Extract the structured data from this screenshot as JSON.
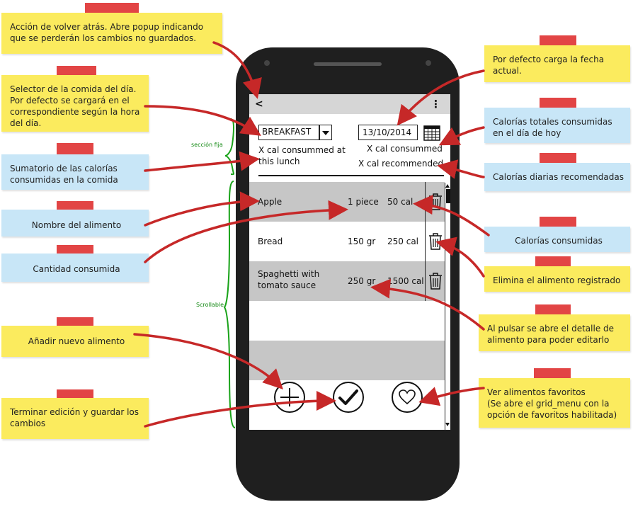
{
  "notes": {
    "back": "Acción de volver atrás. Abre popup indicando que se perderán los cambios no guardados.",
    "selector": "Selector de la comida del día. Por defecto se cargará en el correspondiente según la hora del día.",
    "sum_meal": "Sumatorio de las calorías consumidas en la comida",
    "food_name": "Nombre del alimento",
    "amount": "Cantidad consumida",
    "add_food": "Añadir nuevo alimento",
    "finish": "Terminar edición y guardar los cambios",
    "date": "Por defecto carga la fecha actual.",
    "total_day": "Calorías totales consumidas en el día de hoy",
    "daily_recommended": "Calorías diarias recomendadas",
    "calories": "Calorías consumidas",
    "delete": "Elimina el alimento registrado",
    "detail": "Al pulsar se abre el detalle de alimento para poder editarlo",
    "favorites": "Ver alimentos favoritos\n(Se abre el grid_menu con la opción de favoritos habilitada)"
  },
  "brackets": {
    "fixed": "sección fija",
    "scroll": "Scrollable"
  },
  "screen": {
    "back_glyph": "<",
    "overflow_glyph": "⋮",
    "meal": "BREAKFAST",
    "date": "13/10/2014",
    "meal_calories": "X cal consummed at this lunch",
    "day_consumed": "X cal consummed",
    "day_recommended": "X cal recommended",
    "foods": [
      {
        "name": "Apple",
        "amount": "1 piece",
        "cal": "50 cal"
      },
      {
        "name": "Bread",
        "amount": "150 gr",
        "cal": "250 cal"
      },
      {
        "name": "Spaghetti with tomato sauce",
        "amount": "250 gr",
        "cal": "1500 cal"
      }
    ]
  },
  "colors": {
    "note_yellow": "#fbeb5e",
    "note_blue": "#c8e6f7",
    "tape": "#e03535",
    "arrow": "#c62828",
    "bracket": "#1aa31a"
  }
}
